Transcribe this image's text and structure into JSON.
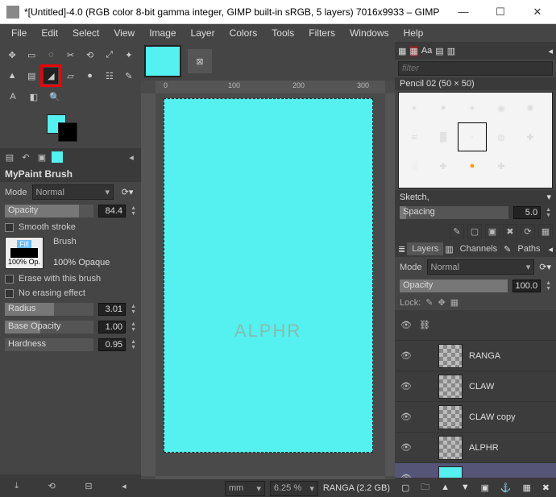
{
  "window": {
    "title": "*[Untitled]-4.0 (RGB color 8-bit gamma integer, GIMP built-in sRGB, 5 layers) 7016x9933 – GIMP"
  },
  "menu": [
    "File",
    "Edit",
    "Select",
    "View",
    "Image",
    "Layer",
    "Colors",
    "Tools",
    "Filters",
    "Windows",
    "Help"
  ],
  "toolbox": {
    "selected": "mypaint-brush"
  },
  "tool_options": {
    "title": "MyPaint Brush",
    "mode_label": "Mode",
    "mode_value": "Normal",
    "opacity_label": "Opacity",
    "opacity_value": "84.4",
    "smooth_stroke": "Smooth stroke",
    "brush_label": "Brush",
    "brush_name": "100% Opaque",
    "brush_badge_top": "Fill",
    "brush_badge_bottom": "100% Op.",
    "erase_label": "Erase with this brush",
    "noerase_label": "No erasing effect",
    "radius_label": "Radius",
    "radius_value": "3.01",
    "baseop_label": "Base Opacity",
    "baseop_value": "1.00",
    "hardness_label": "Hardness",
    "hardness_value": "0.95"
  },
  "canvas": {
    "ruler_marks": [
      "0",
      "100",
      "200",
      "300"
    ],
    "watermark": "ALPHR",
    "units": "mm",
    "zoom": "6.25 %",
    "status": "RANGA (2.2 GB)"
  },
  "right": {
    "filter_placeholder": "filter",
    "brush_name": "Pencil 02 (50 × 50)",
    "sketch": "Sketch,",
    "spacing_label": "Spacing",
    "spacing_value": "5.0",
    "tabs": {
      "layers": "Layers",
      "channels": "Channels",
      "paths": "Paths"
    },
    "mode_label": "Mode",
    "mode_value": "Normal",
    "opacity_label": "Opacity",
    "opacity_value": "100.0",
    "lock_label": "Lock:",
    "layers": [
      {
        "name": "RANGA"
      },
      {
        "name": "CLAW"
      },
      {
        "name": "CLAW copy"
      },
      {
        "name": "ALPHR"
      },
      {
        "name": ""
      }
    ]
  }
}
